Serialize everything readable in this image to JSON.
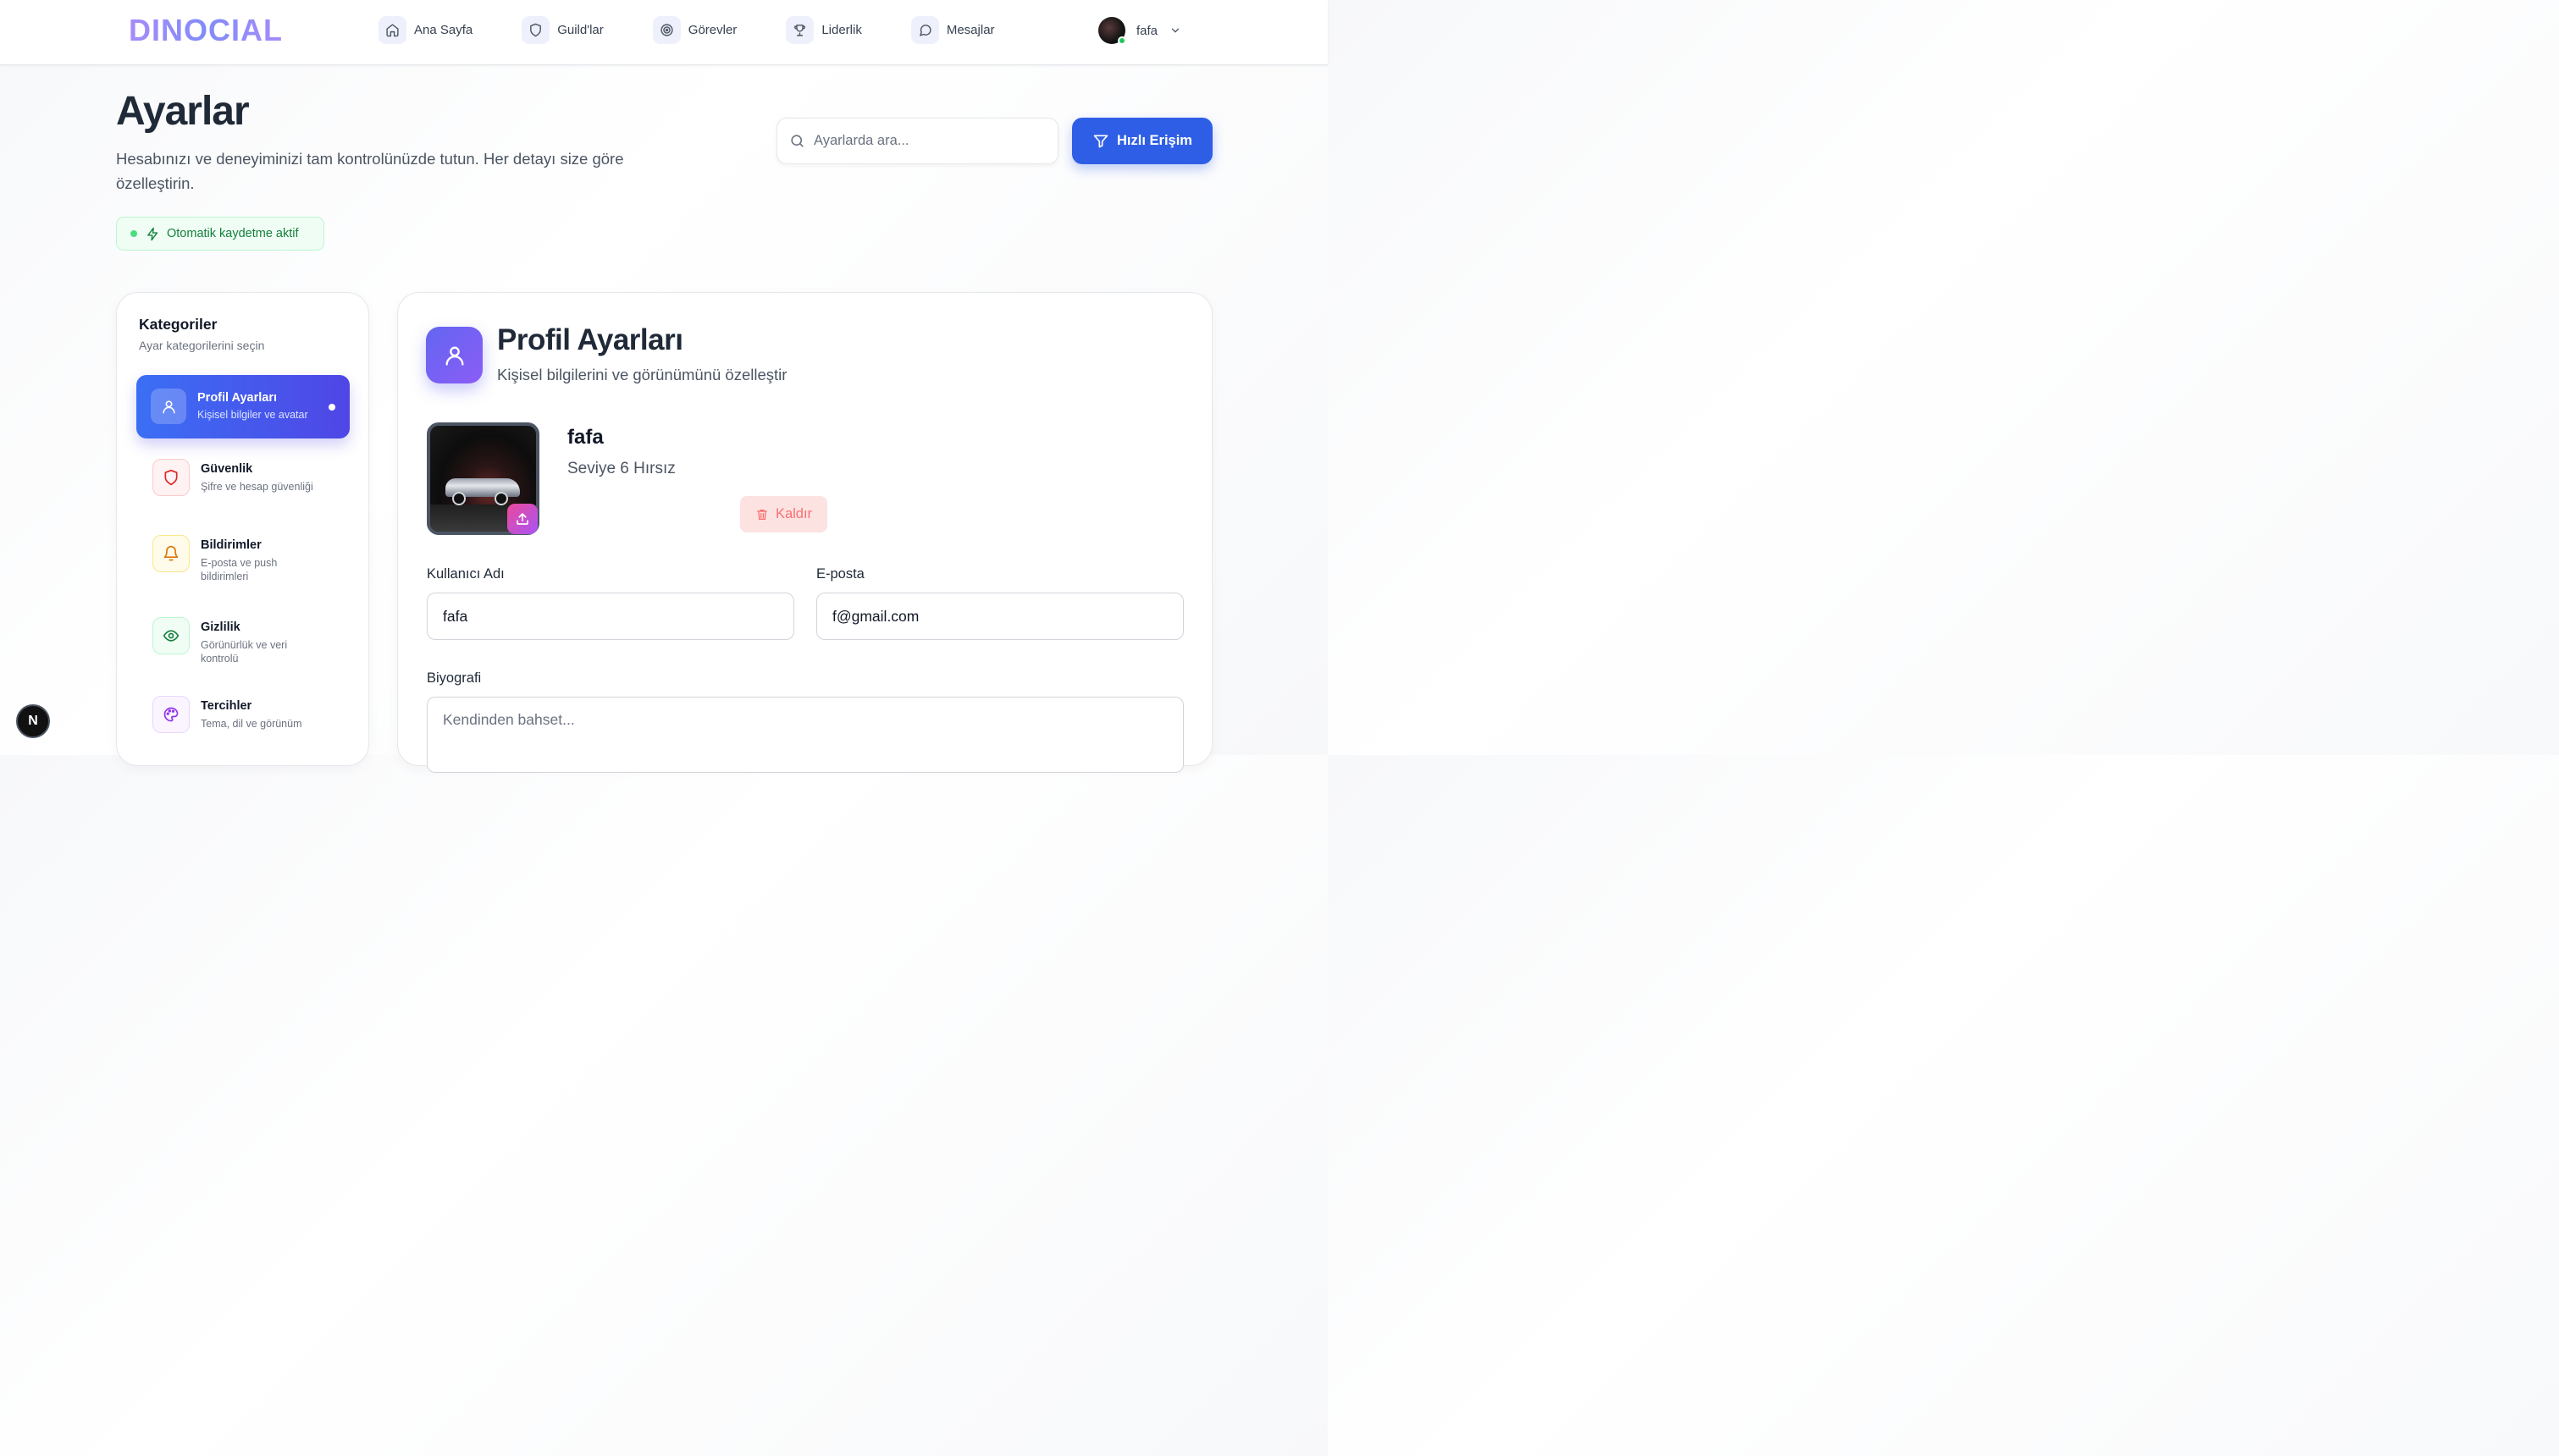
{
  "app": {
    "logo": "DINOCIAL"
  },
  "nav": {
    "items": [
      {
        "label": "Ana Sayfa",
        "icon": "home-icon"
      },
      {
        "label": "Guild'lar",
        "icon": "shield-icon"
      },
      {
        "label": "Görevler",
        "icon": "target-icon"
      },
      {
        "label": "Liderlik",
        "icon": "trophy-icon"
      },
      {
        "label": "Mesajlar",
        "icon": "message-icon"
      }
    ],
    "user": {
      "name": "fafa",
      "status_color": "#22c55e"
    }
  },
  "header": {
    "title": "Ayarlar",
    "description": "Hesabınızı ve deneyiminizi tam kontrolünüzde tutun. Her detayı size göre özelleştirin.",
    "autosave": "Otomatik kaydetme aktif",
    "search_placeholder": "Ayarlarda ara...",
    "quick_access": "Hızlı Erişim"
  },
  "sidebar": {
    "title": "Kategoriler",
    "subtitle": "Ayar kategorilerini seçin",
    "items": [
      {
        "label": "Profil Ayarları",
        "desc": "Kişisel bilgiler ve avatar",
        "icon": "user-icon",
        "active": true
      },
      {
        "label": "Güvenlik",
        "desc": "Şifre ve hesap güvenliği",
        "icon": "shield-icon",
        "color": "#dc2626"
      },
      {
        "label": "Bildirimler",
        "desc": "E-posta ve push bildirimleri",
        "icon": "bell-icon",
        "color": "#d97706"
      },
      {
        "label": "Gizlilik",
        "desc": "Görünürlük ve veri kontrolü",
        "icon": "eye-icon",
        "color": "#15803d"
      },
      {
        "label": "Tercihler",
        "desc": "Tema, dil ve görünüm",
        "icon": "palette-icon",
        "color": "#9333ea"
      }
    ]
  },
  "profile": {
    "title": "Profil Ayarları",
    "subtitle": "Kişisel bilgilerini ve görünümünü özelleştir",
    "name": "fafa",
    "level": "Seviye 6 Hırsız",
    "remove": "Kaldır",
    "username_label": "Kullanıcı Adı",
    "username_value": "fafa",
    "email_label": "E-posta",
    "email_value": "f@gmail.com",
    "bio_label": "Biyografi",
    "bio_placeholder": "Kendinden bahset..."
  },
  "badge": "N",
  "colors": {
    "primary": "#2f5ee6",
    "accent_gradient_start": "#3b6ff5",
    "accent_gradient_end": "#4f46e5",
    "success": "#15803d"
  }
}
